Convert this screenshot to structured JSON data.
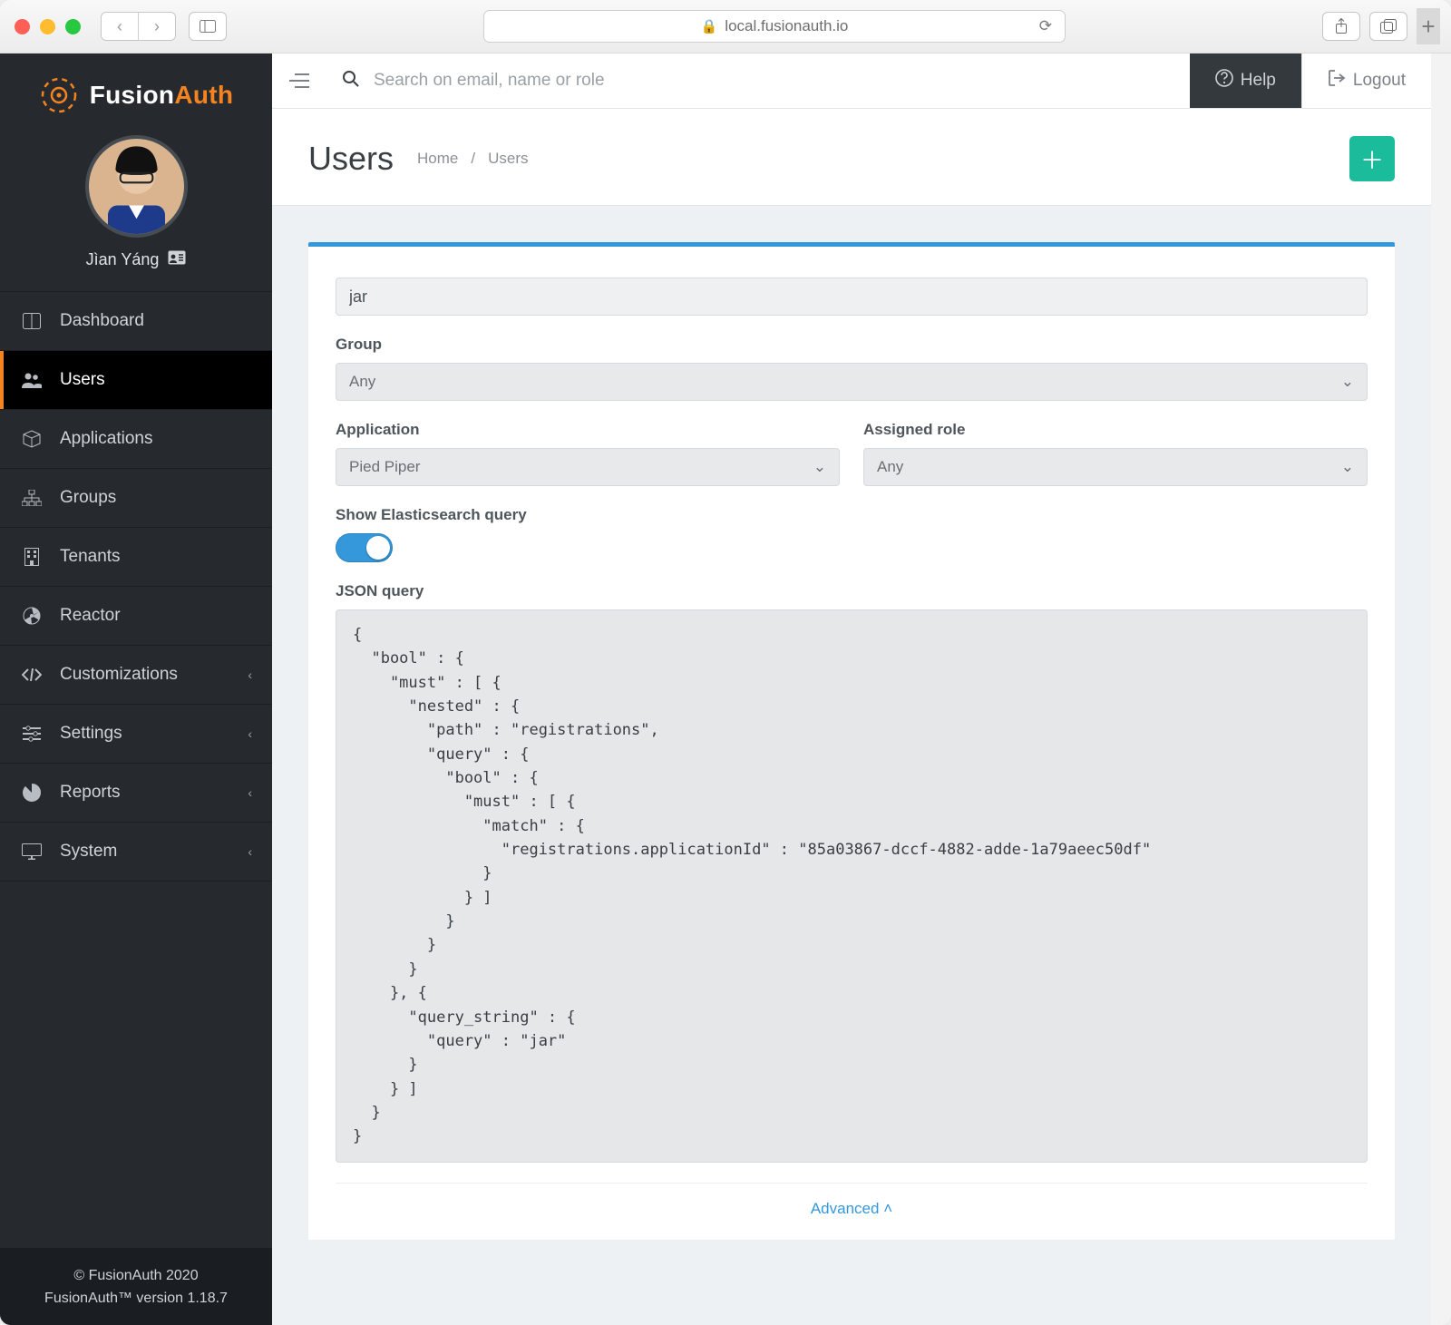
{
  "browser": {
    "address": "local.fusionauth.io"
  },
  "brand": {
    "name_left": "Fusion",
    "name_right": "Auth"
  },
  "user": {
    "display_name": "Jìan Yáng"
  },
  "sidebar": {
    "items": [
      {
        "label": "Dashboard"
      },
      {
        "label": "Users"
      },
      {
        "label": "Applications"
      },
      {
        "label": "Groups"
      },
      {
        "label": "Tenants"
      },
      {
        "label": "Reactor"
      },
      {
        "label": "Customizations"
      },
      {
        "label": "Settings"
      },
      {
        "label": "Reports"
      },
      {
        "label": "System"
      }
    ],
    "footer_line1": "© FusionAuth 2020",
    "footer_line2": "FusionAuth™ version 1.18.7"
  },
  "topbar": {
    "search_placeholder": "Search on email, name or role",
    "help": "Help",
    "logout": "Logout"
  },
  "page": {
    "title": "Users",
    "breadcrumb_home": "Home",
    "breadcrumb_current": "Users"
  },
  "form": {
    "search_value": "jar",
    "group_label": "Group",
    "group_value": "Any",
    "application_label": "Application",
    "application_value": "Pied Piper",
    "assigned_role_label": "Assigned role",
    "assigned_role_value": "Any",
    "show_es_label": "Show Elasticsearch query",
    "json_label": "JSON query",
    "advanced": "Advanced"
  },
  "json_query": "{\n  \"bool\" : {\n    \"must\" : [ {\n      \"nested\" : {\n        \"path\" : \"registrations\",\n        \"query\" : {\n          \"bool\" : {\n            \"must\" : [ {\n              \"match\" : {\n                \"registrations.applicationId\" : \"85a03867-dccf-4882-adde-1a79aeec50df\"\n              }\n            } ]\n          }\n        }\n      }\n    }, {\n      \"query_string\" : {\n        \"query\" : \"jar\"\n      }\n    } ]\n  }\n}"
}
